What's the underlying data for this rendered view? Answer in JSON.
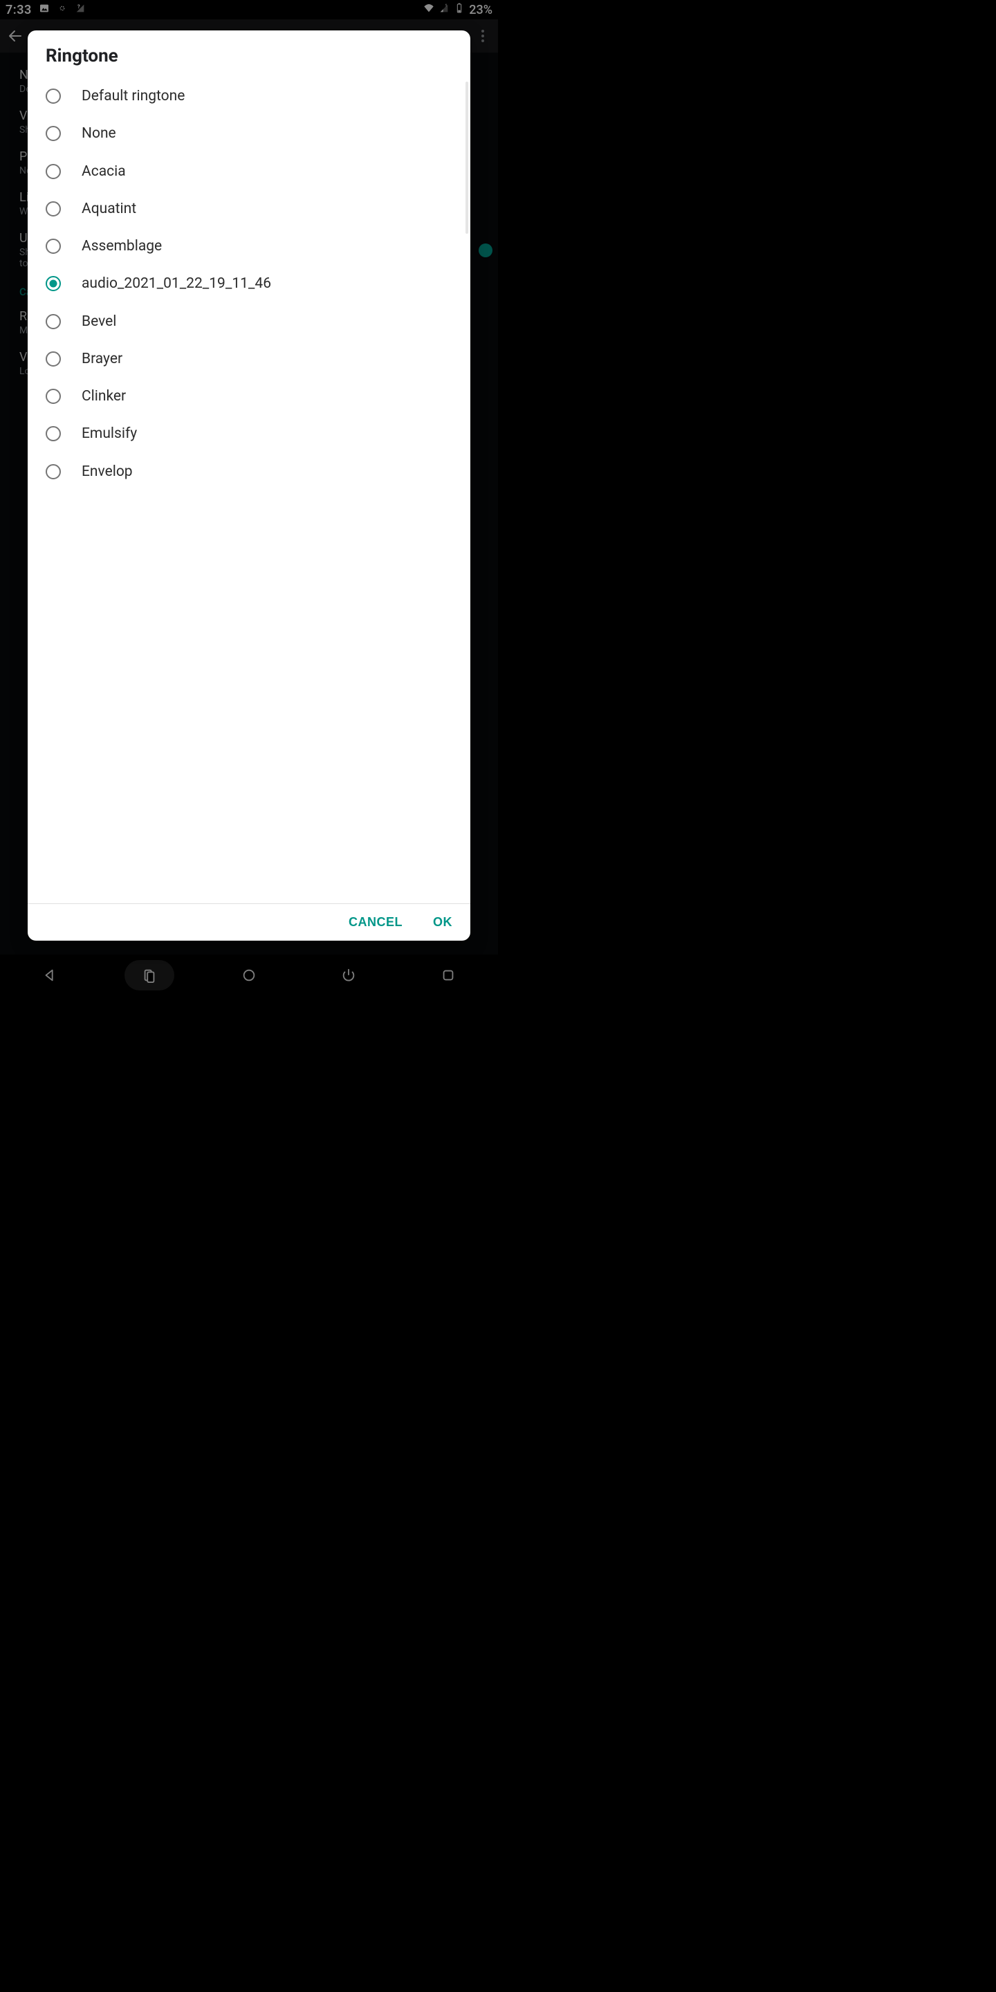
{
  "statusbar": {
    "time": "7:33",
    "battery_text": "23%"
  },
  "background": {
    "items": [
      {
        "title": "N",
        "sub": "De"
      },
      {
        "title": "Vi",
        "sub": "Sh"
      },
      {
        "title": "Po",
        "sub": "Ne"
      },
      {
        "title": "Li",
        "sub": "W"
      },
      {
        "title": "Us",
        "sub": "Sh\nto",
        "toggle": true
      }
    ],
    "section": "Ca",
    "after": [
      {
        "title": "Ri",
        "sub": "M"
      },
      {
        "title": "Vi",
        "sub": "Lo"
      }
    ]
  },
  "dialog": {
    "title": "Ringtone",
    "options": [
      {
        "label": "Default ringtone",
        "selected": false
      },
      {
        "label": "None",
        "selected": false
      },
      {
        "label": "Acacia",
        "selected": false
      },
      {
        "label": "Aquatint",
        "selected": false
      },
      {
        "label": "Assemblage",
        "selected": false
      },
      {
        "label": "audio_2021_01_22_19_11_46",
        "selected": true
      },
      {
        "label": "Bevel",
        "selected": false
      },
      {
        "label": "Brayer",
        "selected": false
      },
      {
        "label": "Clinker",
        "selected": false
      },
      {
        "label": "Emulsify",
        "selected": false
      },
      {
        "label": "Envelop",
        "selected": false
      }
    ],
    "cancel": "CANCEL",
    "ok": "OK"
  }
}
